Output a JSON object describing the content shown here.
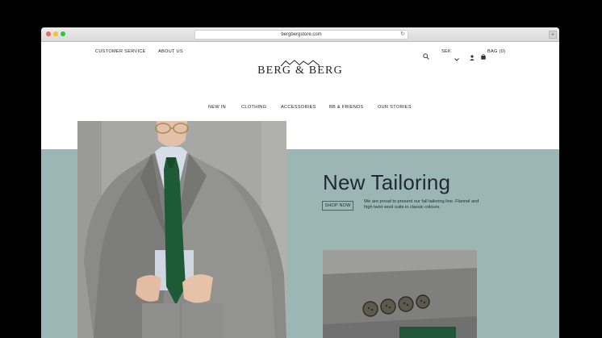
{
  "browser": {
    "url": "bergbergstore.com"
  },
  "header": {
    "top_links": [
      "CUSTOMER SERVICE",
      "ABOUT US"
    ],
    "currency": "SEK",
    "bag_label": "BAG (0)",
    "logo_text": "BERG & BERG"
  },
  "nav": {
    "items": [
      "NEW IN",
      "CLOTHING",
      "ACCESSORIES",
      "BB & FRIENDS",
      "OUR STORIES"
    ]
  },
  "hero": {
    "title": "New Tailoring",
    "cta_label": "SHOP NOW",
    "description": "We are proud to present our fall tailoring line. Flannel and high twist wool suits in classic colours."
  },
  "colors": {
    "teal_band": "#9bb6b5",
    "tie_green": "#1f5a36",
    "suit_grey": "#8a8a8a"
  }
}
